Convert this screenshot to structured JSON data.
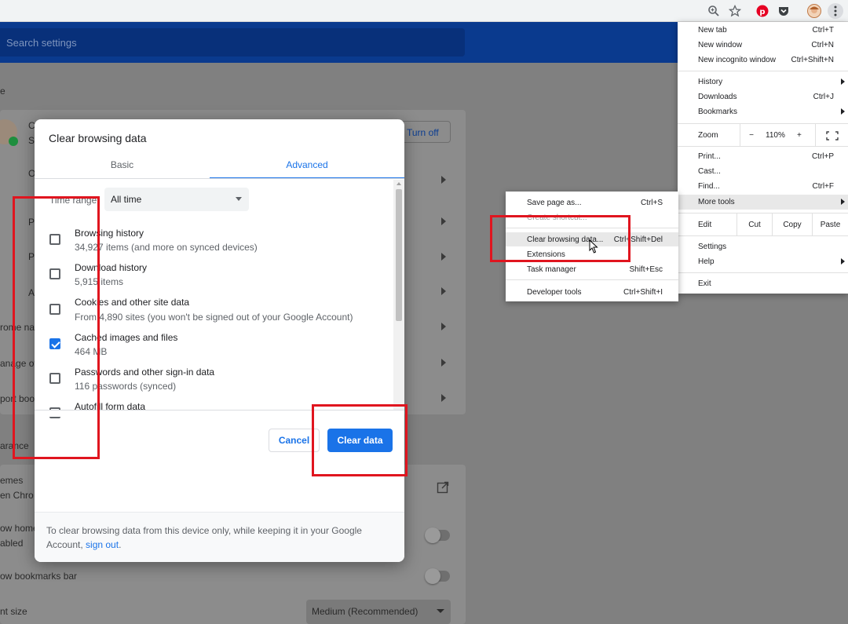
{
  "search": {
    "placeholder": "Search settings"
  },
  "background": {
    "partial_labels": [
      "e",
      "C",
      "S",
      "O",
      "P",
      "P",
      "A",
      "rome na",
      "anage oth",
      "port boo",
      "arance",
      "emes",
      "en Chro",
      "ow home",
      "abled",
      "ow bookmarks bar",
      "nt size"
    ],
    "turn_off_label": "Turn off",
    "font_size_value": "Medium (Recommended)"
  },
  "dialog": {
    "title": "Clear browsing data",
    "tabs": [
      "Basic",
      "Advanced"
    ],
    "active_tab": "Advanced",
    "time_range_label": "Time range",
    "time_range_value": "All time",
    "options": [
      {
        "title": "Browsing history",
        "subtitle": "34,927 items (and more on synced devices)",
        "checked": false
      },
      {
        "title": "Download history",
        "subtitle": "5,915 items",
        "checked": false
      },
      {
        "title": "Cookies and other site data",
        "subtitle": "From 4,890 sites (you won't be signed out of your Google Account)",
        "checked": false
      },
      {
        "title": "Cached images and files",
        "subtitle": "464 MB",
        "checked": true
      },
      {
        "title": "Passwords and other sign-in data",
        "subtitle": "116 passwords (synced)",
        "checked": false
      },
      {
        "title": "Autofill form data",
        "subtitle": "",
        "checked": false
      }
    ],
    "cancel_label": "Cancel",
    "clear_label": "Clear data",
    "footer_text": "To clear browsing data from this device only, while keeping it in your Google Account, ",
    "footer_link": "sign out",
    "footer_end": "."
  },
  "menu": {
    "items": [
      {
        "label": "New tab",
        "shortcut": "Ctrl+T"
      },
      {
        "label": "New window",
        "shortcut": "Ctrl+N"
      },
      {
        "label": "New incognito window",
        "shortcut": "Ctrl+Shift+N"
      },
      {
        "label": "History",
        "shortcut": ""
      },
      {
        "label": "Downloads",
        "shortcut": "Ctrl+J"
      },
      {
        "label": "Bookmarks",
        "shortcut": ""
      },
      {
        "label": "Print...",
        "shortcut": "Ctrl+P"
      },
      {
        "label": "Cast...",
        "shortcut": ""
      },
      {
        "label": "Find...",
        "shortcut": "Ctrl+F"
      },
      {
        "label": "More tools",
        "shortcut": ""
      },
      {
        "label": "Settings",
        "shortcut": ""
      },
      {
        "label": "Help",
        "shortcut": ""
      },
      {
        "label": "Exit",
        "shortcut": ""
      }
    ],
    "zoom": {
      "label": "Zoom",
      "minus": "−",
      "value": "110%",
      "plus": "+"
    },
    "edit": {
      "label": "Edit",
      "cut": "Cut",
      "copy": "Copy",
      "paste": "Paste"
    }
  },
  "submenu": {
    "items": [
      {
        "label": "Save page as...",
        "shortcut": "Ctrl+S"
      },
      {
        "label": "Create shortcut...",
        "shortcut": ""
      },
      {
        "label": "Clear browsing data...",
        "shortcut": "Ctrl+Shift+Del"
      },
      {
        "label": "Extensions",
        "shortcut": ""
      },
      {
        "label": "Task manager",
        "shortcut": "Shift+Esc"
      },
      {
        "label": "Developer tools",
        "shortcut": "Ctrl+Shift+I"
      }
    ]
  },
  "colors": {
    "accent": "#1a73e8",
    "header_blue": "#0a3a8e",
    "annotation_red": "#e0151f"
  }
}
